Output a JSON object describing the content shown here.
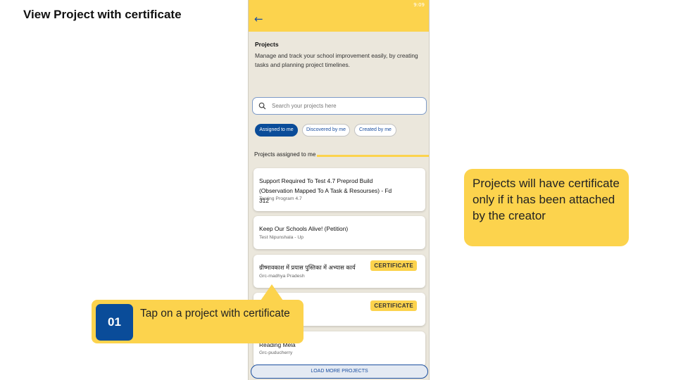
{
  "slide": {
    "title": "View Project with certificate"
  },
  "app": {
    "status_time": "9:09",
    "back_glyph": "←",
    "section_title": "Projects",
    "section_desc": "Manage and track your school improvement easily, by creating tasks and planning project timelines.",
    "search": {
      "placeholder": "Search your projects here",
      "value": ""
    },
    "tabs": [
      {
        "label": "Assigned to me",
        "active": true
      },
      {
        "label": "Discovered by me",
        "active": false
      },
      {
        "label": "Created by me",
        "active": false
      }
    ],
    "list_header": "Projects assigned to me",
    "projects": [
      {
        "title": "Support Required To Test 4.7 Preprod Build (Observation Mapped To A Task & Resourses) - Fd 312",
        "subtitle": "Testing Program 4.7",
        "badge": ""
      },
      {
        "title": "Keep Our Schools Alive! (Petition)",
        "subtitle": "Test Nipunshala - Up",
        "badge": ""
      },
      {
        "title": "ग्रीष्मावकाश में प्रयास पुस्तिका में अभ्यास कार्य",
        "subtitle": "Grc-madhya Pradesh",
        "badge": "CERTIFICATE"
      },
      {
        "title": "",
        "subtitle": "",
        "badge": "CERTIFICATE"
      },
      {
        "title": "Reading Mela",
        "subtitle": "Grc-puducherry",
        "badge": ""
      }
    ],
    "load_more": "LOAD MORE PROJECTS"
  },
  "callouts": {
    "step_number": "01",
    "step_text": "Tap on a project with certificate",
    "note": "Projects will have certificate only if it has been attached by the creator"
  },
  "colors": {
    "accent_yellow": "#fcd34d",
    "primary_blue": "#0a4c99",
    "screen_bg": "#ebe7dc"
  }
}
